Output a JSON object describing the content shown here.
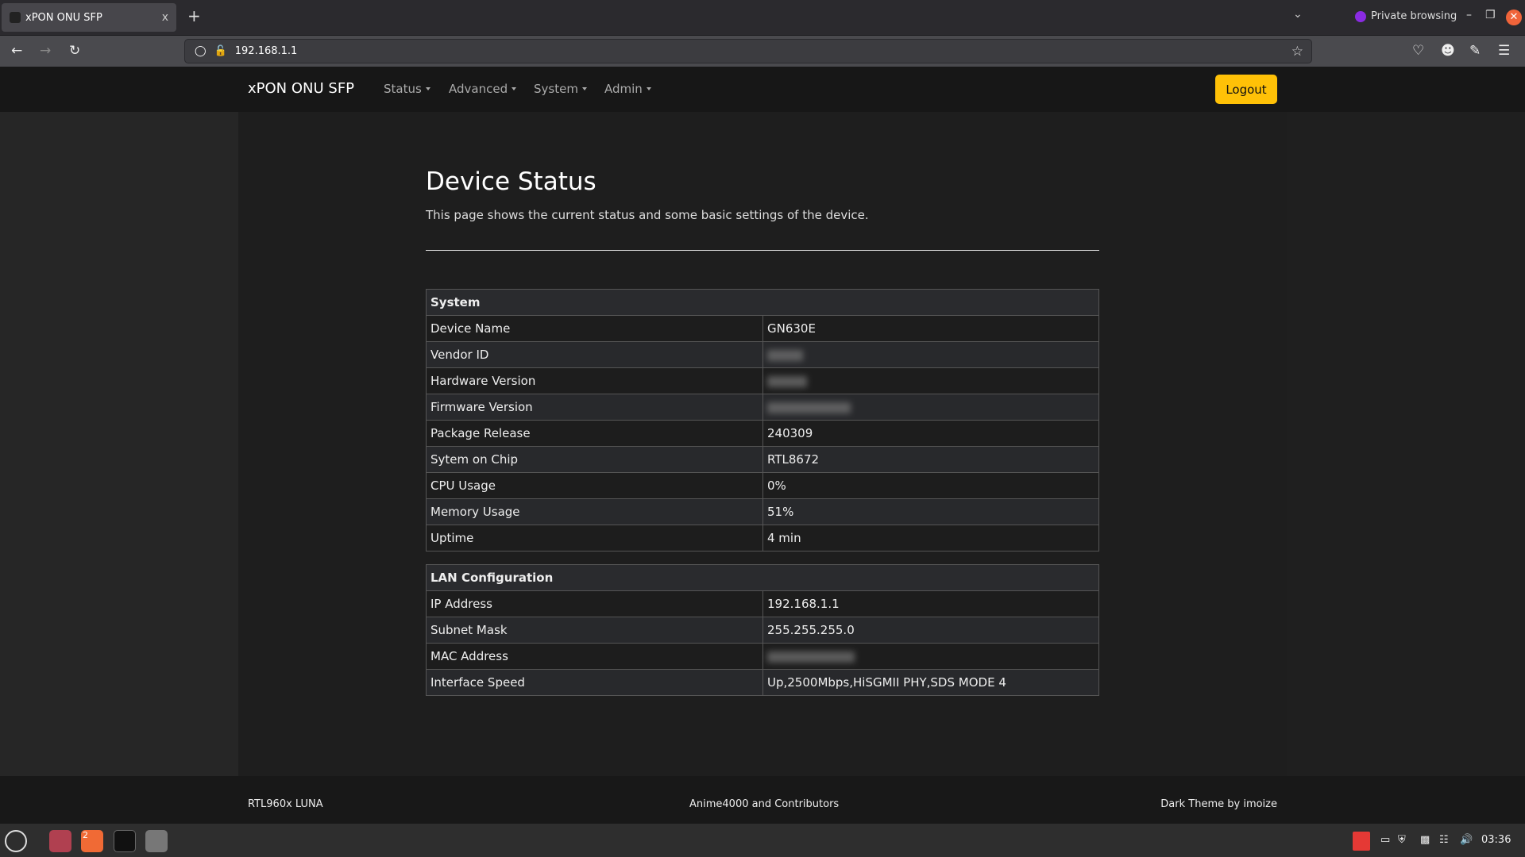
{
  "browser": {
    "tab_title": "xPON ONU SFP",
    "tab_close": "x",
    "new_tab": "+",
    "private_label": "Private browsing",
    "url": "192.168.1.1"
  },
  "nav": {
    "brand": "xPON ONU SFP",
    "items": [
      {
        "label": "Status"
      },
      {
        "label": "Advanced"
      },
      {
        "label": "System"
      },
      {
        "label": "Admin"
      }
    ],
    "logout": "Logout",
    "logout_color": "#ffc107"
  },
  "page": {
    "title": "Device Status",
    "subtitle": "This page shows the current status and some basic settings of the device.",
    "system": {
      "header": "System",
      "rows": [
        {
          "label": "Device Name",
          "value": "GN630E"
        },
        {
          "label": "Vendor ID",
          "value": null,
          "redacted": true
        },
        {
          "label": "Hardware Version",
          "value": null,
          "redacted": true
        },
        {
          "label": "Firmware Version",
          "value": null,
          "redacted": true
        },
        {
          "label": "Package Release",
          "value": "240309"
        },
        {
          "label": "Sytem on Chip",
          "value": "RTL8672"
        },
        {
          "label": "CPU Usage",
          "value": "0%"
        },
        {
          "label": "Memory Usage",
          "value": "51%"
        },
        {
          "label": "Uptime",
          "value": "4 min"
        }
      ]
    },
    "lan": {
      "header": "LAN Configuration",
      "rows": [
        {
          "label": "IP Address",
          "value": "192.168.1.1"
        },
        {
          "label": "Subnet Mask",
          "value": "255.255.255.0"
        },
        {
          "label": "MAC Address",
          "value": null,
          "redacted": true
        },
        {
          "label": "Interface Speed",
          "value": "Up,2500Mbps,HiSGMII PHY,SDS MODE 4"
        }
      ]
    }
  },
  "footer": {
    "left": "RTL960x LUNA",
    "center": "Anime4000 and Contributors",
    "right": "Dark Theme by imoize"
  },
  "taskbar": {
    "clock": "03:36",
    "firefox_badge": "2"
  }
}
